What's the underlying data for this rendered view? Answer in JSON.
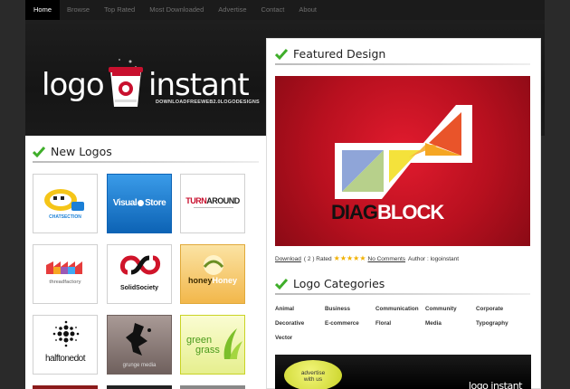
{
  "nav": {
    "items": [
      {
        "label": "Home",
        "active": true
      },
      {
        "label": "Browse",
        "active": false
      },
      {
        "label": "Top Rated",
        "active": false
      },
      {
        "label": "Most Downloaded",
        "active": false
      },
      {
        "label": "Advertise",
        "active": false
      },
      {
        "label": "Contact",
        "active": false
      },
      {
        "label": "About",
        "active": false
      }
    ]
  },
  "brand": {
    "word1": "logo",
    "word2": "instant",
    "tagline": "DOWNLOADFREEWEB2.0LOGODESIGNS",
    "cup_text": "logoinstant"
  },
  "new_logos": {
    "title": "New Logos",
    "items": [
      {
        "name": "CHATSECTION",
        "prefix": "CHAT",
        "suffix": "SECTION"
      },
      {
        "name": "VisualStore",
        "prefix": "Visual",
        "suffix": "Store"
      },
      {
        "name": "TURNAROUND",
        "prefix": "TURN",
        "suffix": "AROUND"
      },
      {
        "name": "threadfactory",
        "prefix": "thread",
        "suffix": "factory"
      },
      {
        "name": "SolidSociety"
      },
      {
        "name": "honeyHoney",
        "prefix": "honey",
        "suffix": "Honey"
      },
      {
        "name": "halftonedot"
      },
      {
        "name": "grunge media"
      },
      {
        "name": "green grass",
        "prefix": "green",
        "suffix": "grass"
      }
    ]
  },
  "featured": {
    "title": "Featured Design",
    "name_left": "DIAG",
    "name_right": "BLOCK",
    "download_label": "Download",
    "rating_count": "( 2 ) Rated",
    "rating": 5,
    "comments_label": "No Comments",
    "author_label": "Author : logoinstant"
  },
  "categories": {
    "title": "Logo Categories",
    "items": [
      "Animal",
      "Business",
      "Communication",
      "Community",
      "Corporate",
      "Decorative",
      "E-commerce",
      "Floral",
      "Media",
      "Typography",
      "Vector"
    ]
  },
  "ad": {
    "line1": "advertise",
    "line2": "with us",
    "brand": "logo instant"
  },
  "colors": {
    "accent_green": "#3fae2a",
    "featured_red": "#d0142a",
    "visual_blue": "#1a7fd6"
  }
}
